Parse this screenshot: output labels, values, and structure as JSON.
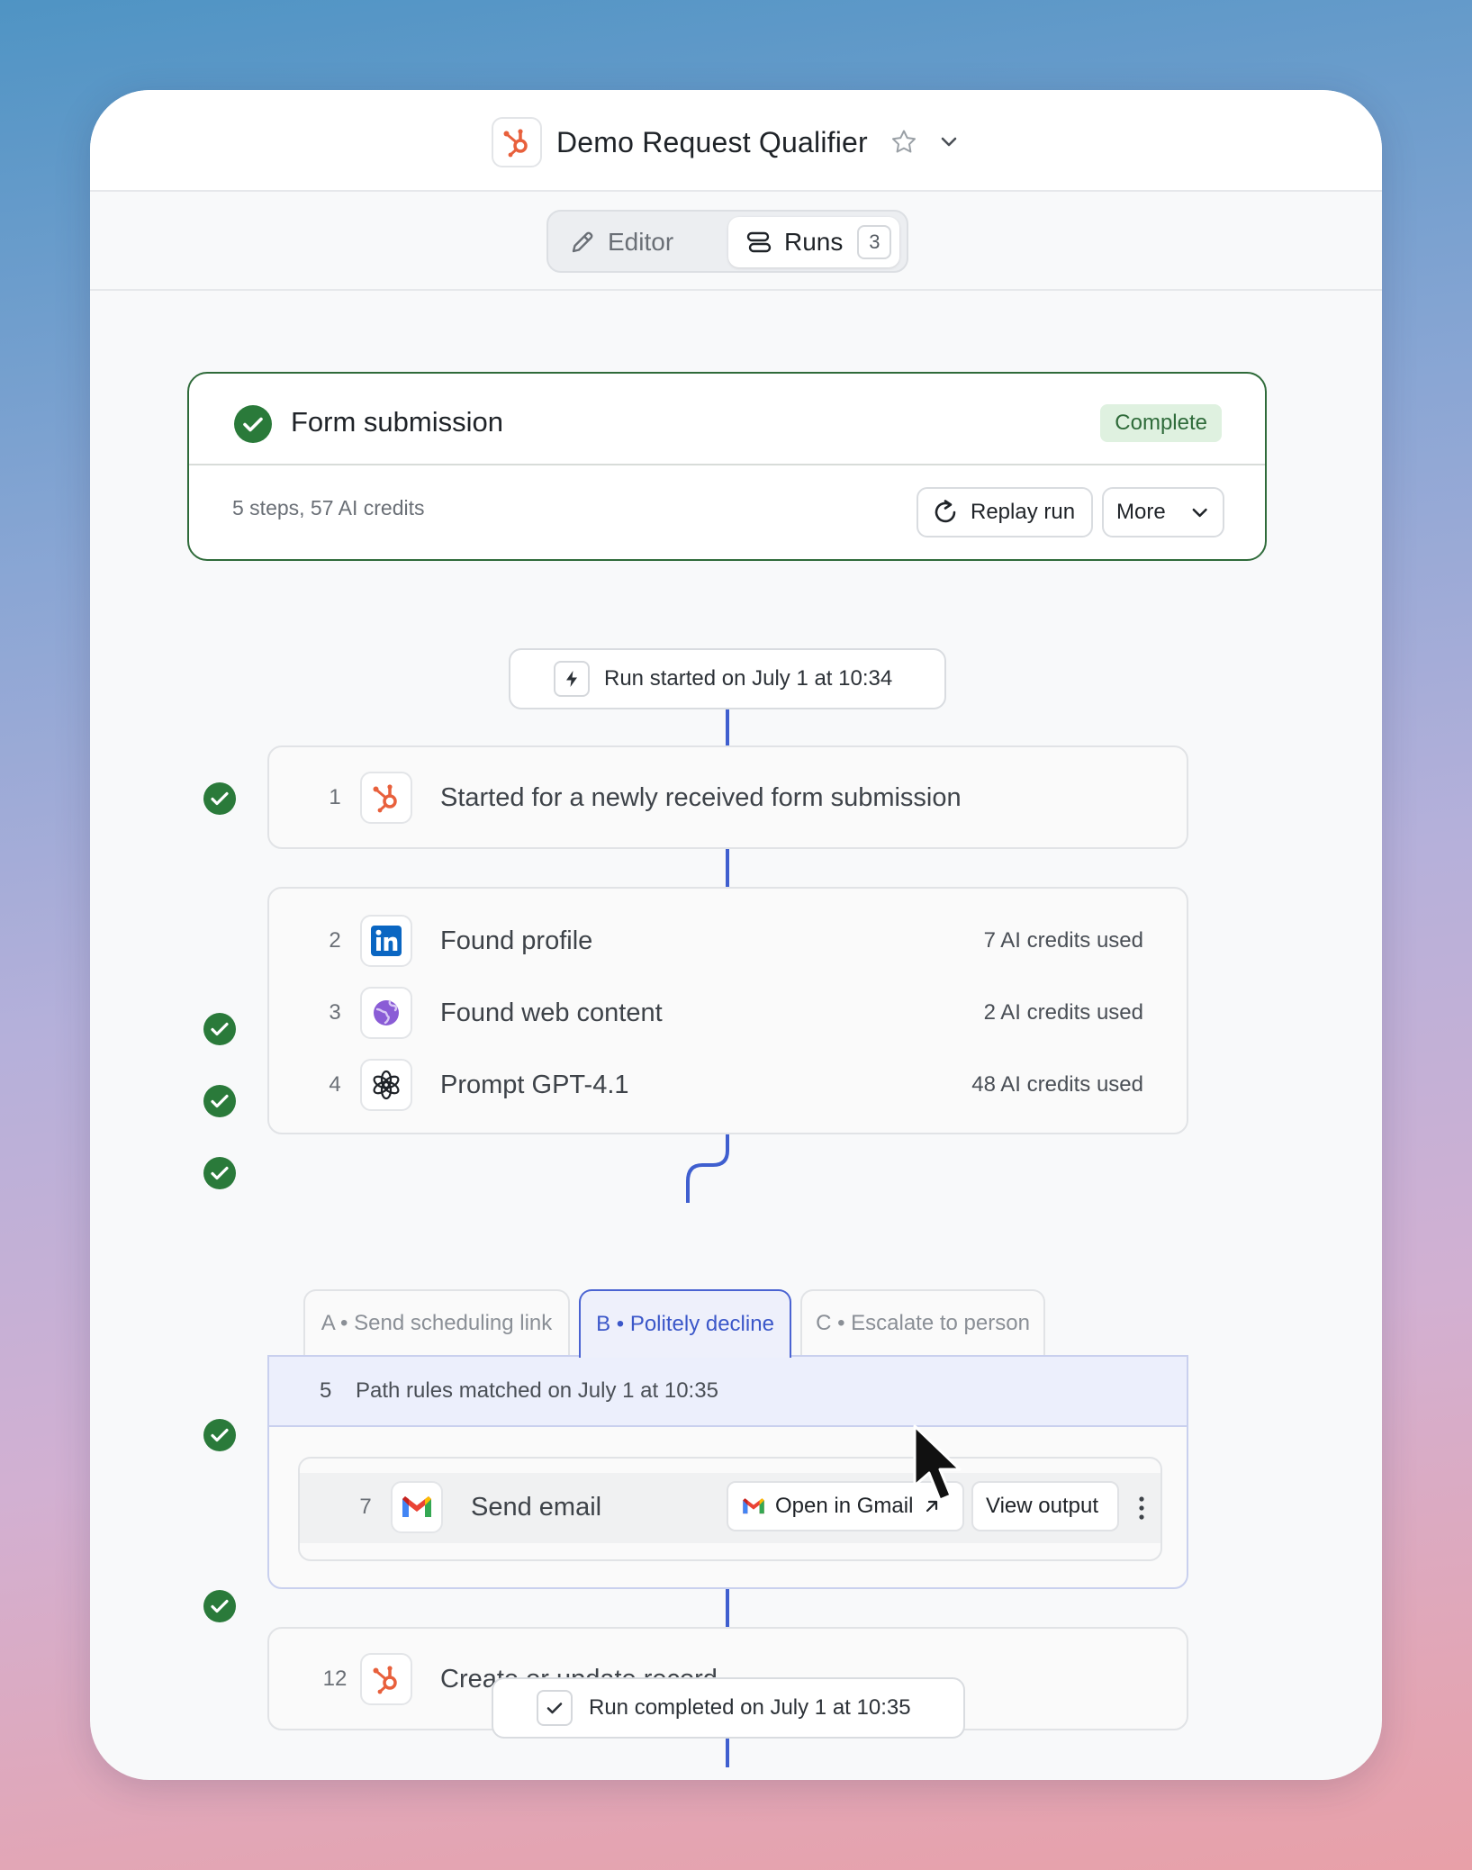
{
  "window": {
    "title": "Demo Request Qualifier"
  },
  "tabs": {
    "editor_label": "Editor",
    "runs_label": "Runs",
    "runs_count": "3"
  },
  "summary": {
    "title": "Form submission",
    "status": "Complete",
    "meta": "5 steps,  57 AI credits",
    "replay_label": "Replay run",
    "more_label": "More"
  },
  "run": {
    "started": "Run started on July 1 at 10:34",
    "completed": "Run completed on July 1 at 10:35"
  },
  "steps": [
    {
      "num": "1",
      "icon": "hubspot-icon",
      "label": "Started for a newly received form submission",
      "credits": ""
    },
    {
      "num": "2",
      "icon": "linkedin-icon",
      "label": "Found profile",
      "credits": "7 AI credits used"
    },
    {
      "num": "3",
      "icon": "web-globe-icon",
      "label": "Found web content",
      "credits": "2 AI credits used"
    },
    {
      "num": "4",
      "icon": "openai-icon",
      "label": "Prompt GPT-4.1",
      "credits": "48 AI credits used"
    }
  ],
  "paths": {
    "tabs": [
      {
        "label": "A • Send scheduling link",
        "active": false
      },
      {
        "label": "B • Politely decline",
        "active": true
      },
      {
        "label": "C • Escalate to person",
        "active": false
      }
    ],
    "rule_num": "5",
    "rule_text": "Path rules matched on July 1 at 10:35",
    "step": {
      "num": "7",
      "icon": "gmail-icon",
      "label": "Send email",
      "open_label": "Open in Gmail",
      "view_label": "View output"
    }
  },
  "final_step": {
    "num": "12",
    "icon": "hubspot-icon",
    "label": "Create or update record"
  },
  "colors": {
    "success": "#2a7a3a",
    "accent": "#3f5fcf",
    "hubspot": "#e8603c"
  }
}
